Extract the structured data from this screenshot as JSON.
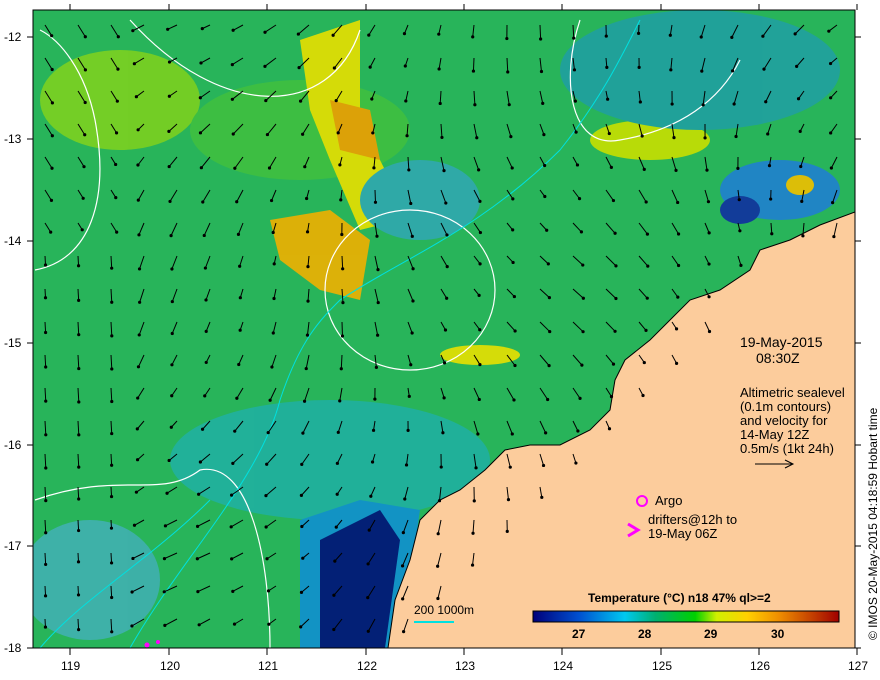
{
  "map": {
    "date": "19-May-2015",
    "time": "08:30Z",
    "altimetry_lines": [
      "Altimetric sealevel",
      "(0.1m contours)",
      "and velocity for",
      "14-May 12Z",
      "0.5m/s (1kt 24h)"
    ],
    "argo_label": "Argo",
    "drifters_lines": [
      "drifters@12h to",
      "19-May 06Z"
    ],
    "depth_contour_label": "200  1000m",
    "colorbar_title": "Temperature (°C) n18 47% ql>=2",
    "colorbar_ticks": [
      "27",
      "28",
      "29",
      "30"
    ],
    "lon_ticks": [
      "119",
      "120",
      "121",
      "122",
      "123",
      "124",
      "125",
      "126",
      "127"
    ],
    "lat_ticks": [
      "-12",
      "-13",
      "-14",
      "-15",
      "-16",
      "-17",
      "-18"
    ],
    "side_credit": "© IMOS 20-May-2015 04:18:59 Hobart time",
    "colors": {
      "land": "#fccc9c",
      "ocean": "#28b45a",
      "argo": "#ff00ff",
      "contour": "#ffffff",
      "depth": "#00e0e0"
    }
  }
}
